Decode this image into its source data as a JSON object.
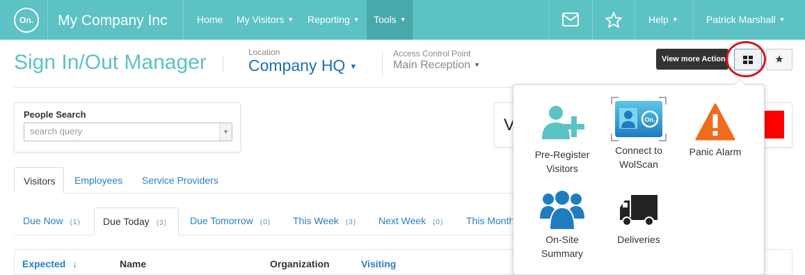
{
  "nav": {
    "logo_text": "On.",
    "brand": "My Company Inc",
    "links": [
      "Home",
      "My Visitors",
      "Reporting",
      "Tools"
    ],
    "help": "Help",
    "user": "Patrick Marshall",
    "accent": "#5cc2c3"
  },
  "header": {
    "title": "Sign In/Out Manager",
    "location_label": "Location",
    "location_value": "Company HQ",
    "acp_label": "Access Control Point",
    "acp_value": "Main Reception",
    "tooltip": "View more Actions"
  },
  "search": {
    "label": "People Search",
    "placeholder": "search query"
  },
  "visitor_card": {
    "text": "V"
  },
  "main_tabs": [
    "Visitors",
    "Employees",
    "Service Providers"
  ],
  "sub_tabs": [
    {
      "label": "Due Now",
      "count": "(1)"
    },
    {
      "label": "Due Today",
      "count": "(3)"
    },
    {
      "label": "Due Tomorrow",
      "count": "(0)"
    },
    {
      "label": "This Week",
      "count": "(3)"
    },
    {
      "label": "Next Week",
      "count": "(0)"
    },
    {
      "label": "This Month",
      "count": ""
    }
  ],
  "table": {
    "headers": [
      "Expected",
      "Name",
      "Organization",
      "Visiting"
    ],
    "sort_indicator": "↓"
  },
  "actions": {
    "items": [
      {
        "label": "Pre-Register Visitors",
        "icon": "add-user-icon"
      },
      {
        "label": "Connect to WolScan",
        "icon": "id-card-scan-icon"
      },
      {
        "label": "Panic Alarm",
        "icon": "warning-triangle-icon"
      },
      {
        "label": "On-Site Summary",
        "icon": "group-icon"
      },
      {
        "label": "Deliveries",
        "icon": "truck-icon"
      }
    ]
  }
}
